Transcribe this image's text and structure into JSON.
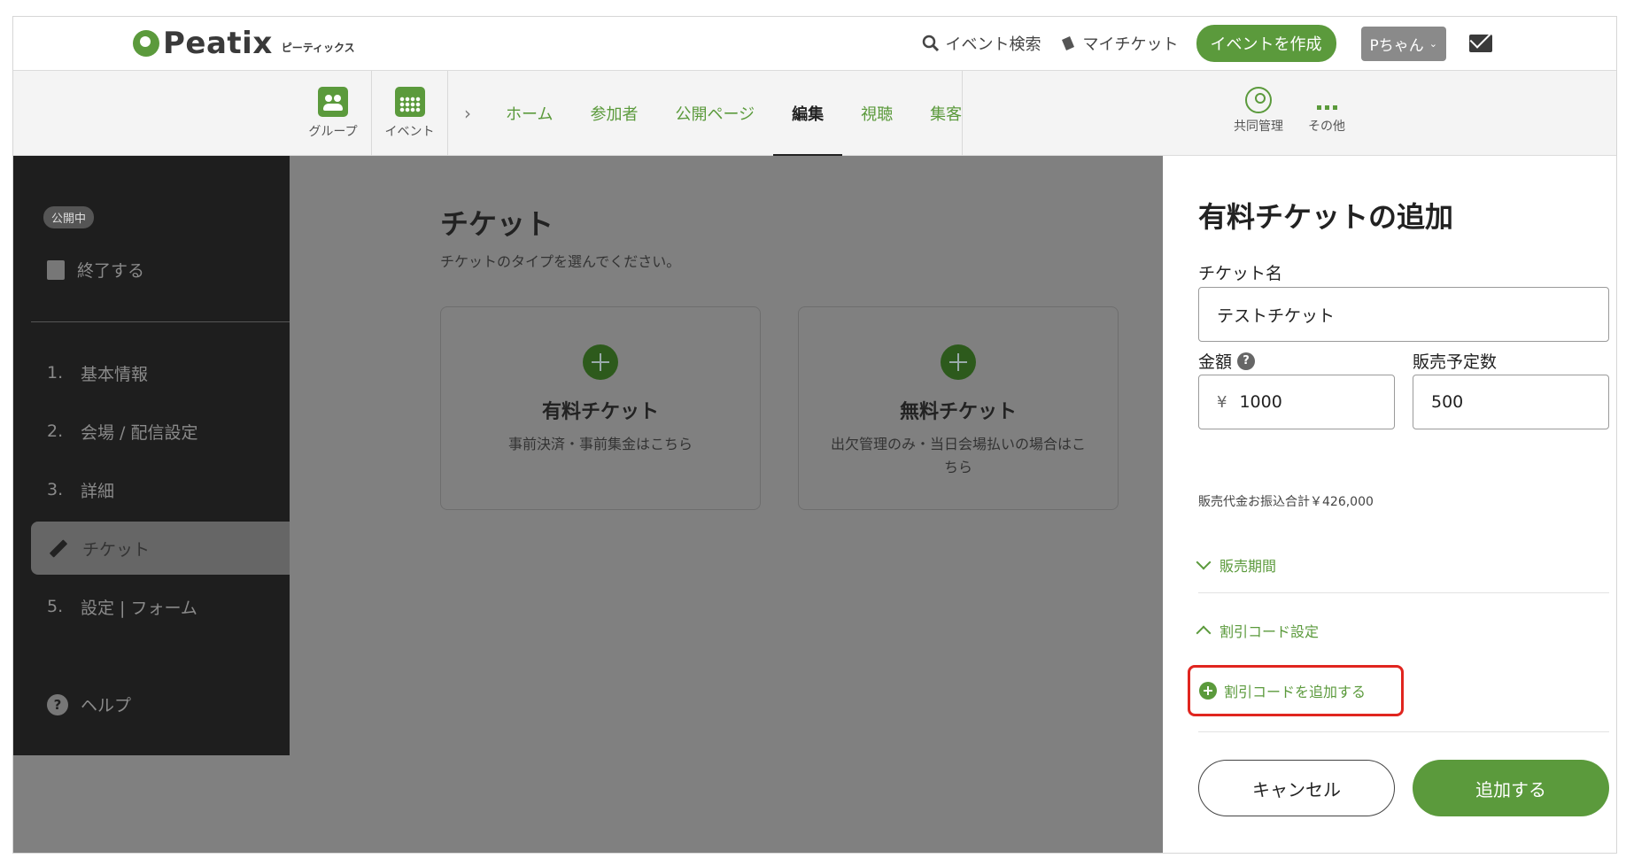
{
  "header": {
    "logo_text": "Peatix",
    "logo_sub": "ピーティックス",
    "search_label": "イベント検索",
    "my_tickets_label": "マイチケット",
    "create_event_label": "イベントを作成",
    "user_label": "Pちゃん"
  },
  "subnav": {
    "group_label": "グループ",
    "event_label": "イベント",
    "breadcrumb_sep": "›",
    "tabs": [
      {
        "label": "ホーム",
        "active": false
      },
      {
        "label": "参加者",
        "active": false
      },
      {
        "label": "公開ページ",
        "active": false
      },
      {
        "label": "編集",
        "active": true
      },
      {
        "label": "視聴",
        "active": false
      },
      {
        "label": "集客",
        "active": false
      }
    ],
    "collab_label": "共同管理",
    "more_label": "その他"
  },
  "sidebar": {
    "status_badge": "公開中",
    "end_label": "終了する",
    "steps": [
      {
        "num": "1.",
        "label": "基本情報"
      },
      {
        "num": "2.",
        "label": "会場 / 配信設定"
      },
      {
        "num": "3.",
        "label": "詳細"
      },
      {
        "num": "",
        "label": "チケット"
      },
      {
        "num": "5.",
        "label": "設定 | フォーム"
      }
    ],
    "help_label": "ヘルプ"
  },
  "main": {
    "title": "チケット",
    "subtitle": "チケットのタイプを選んでください。",
    "cards": [
      {
        "title": "有料チケット",
        "desc": "事前決済・事前集金はこちら"
      },
      {
        "title": "無料チケット",
        "desc": "出欠管理のみ・当日会場払いの場合はこちら"
      }
    ]
  },
  "panel": {
    "title": "有料チケットの追加",
    "ticket_name_label": "チケット名",
    "ticket_name_value": "テストチケット",
    "price_label": "金額",
    "price_help": "?",
    "currency": "¥",
    "price_value": "1000",
    "quantity_label": "販売予定数",
    "quantity_value": "500",
    "payout_text": "販売代金お振込合計￥426,000",
    "sales_period_label": "販売期間",
    "discount_settings_label": "割引コード設定",
    "add_discount_label": "割引コードを追加する",
    "cancel_label": "キャンセル",
    "add_label": "追加する"
  },
  "colors": {
    "brand_green": "#5b9a3c",
    "highlight_red": "#e0251f",
    "sidebar_bg": "#1e1e1e",
    "overlay_grey": "#808080"
  }
}
